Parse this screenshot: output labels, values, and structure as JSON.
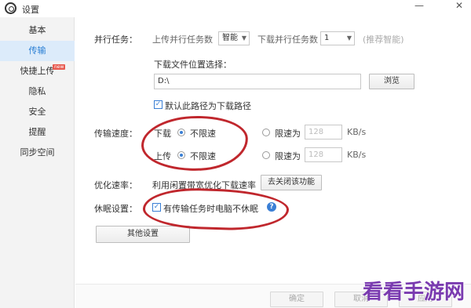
{
  "titlebar": {
    "title": "设置",
    "minimize": "—",
    "close": "✕"
  },
  "sidebar": {
    "items": [
      {
        "label": "基本"
      },
      {
        "label": "传输"
      },
      {
        "label": "快捷上传"
      },
      {
        "label": "隐私"
      },
      {
        "label": "安全"
      },
      {
        "label": "提醒"
      },
      {
        "label": "同步空间"
      }
    ],
    "new_badge": "new",
    "active_index": 1
  },
  "parallel": {
    "label": "并行任务：",
    "upload_label": "上传并行任务数",
    "upload_value": "智能",
    "download_label": "下载并行任务数",
    "download_value": "1",
    "hint": "(推荐智能)"
  },
  "download_location": {
    "label": "下载文件位置选择：",
    "path": "D:\\",
    "browse": "浏览",
    "default_checkbox": "默认此路径为下载路径",
    "default_checked": true
  },
  "speed": {
    "label": "传输速度：",
    "download": {
      "label": "下载",
      "unlimited": "不限速",
      "limit": "限速为",
      "value": "128",
      "unit": "KB/s",
      "selected": "unlimited"
    },
    "upload": {
      "label": "上传",
      "unlimited": "不限速",
      "limit": "限速为",
      "value": "128",
      "unit": "KB/s",
      "selected": "unlimited"
    }
  },
  "optimize": {
    "label": "优化速率：",
    "text": "利用闲置带宽优化下载速率",
    "button": "去关闭该功能"
  },
  "sleep": {
    "label": "休眠设置：",
    "checkbox": "有传输任务时电脑不休眠",
    "checked": true,
    "help": "?"
  },
  "other_settings": "其他设置",
  "footer": {
    "ok": "确定",
    "cancel": "取消",
    "apply": "应用"
  },
  "watermark": "看看手游网",
  "colors": {
    "accent": "#3a7fd5",
    "annotation": "#c0272d"
  }
}
